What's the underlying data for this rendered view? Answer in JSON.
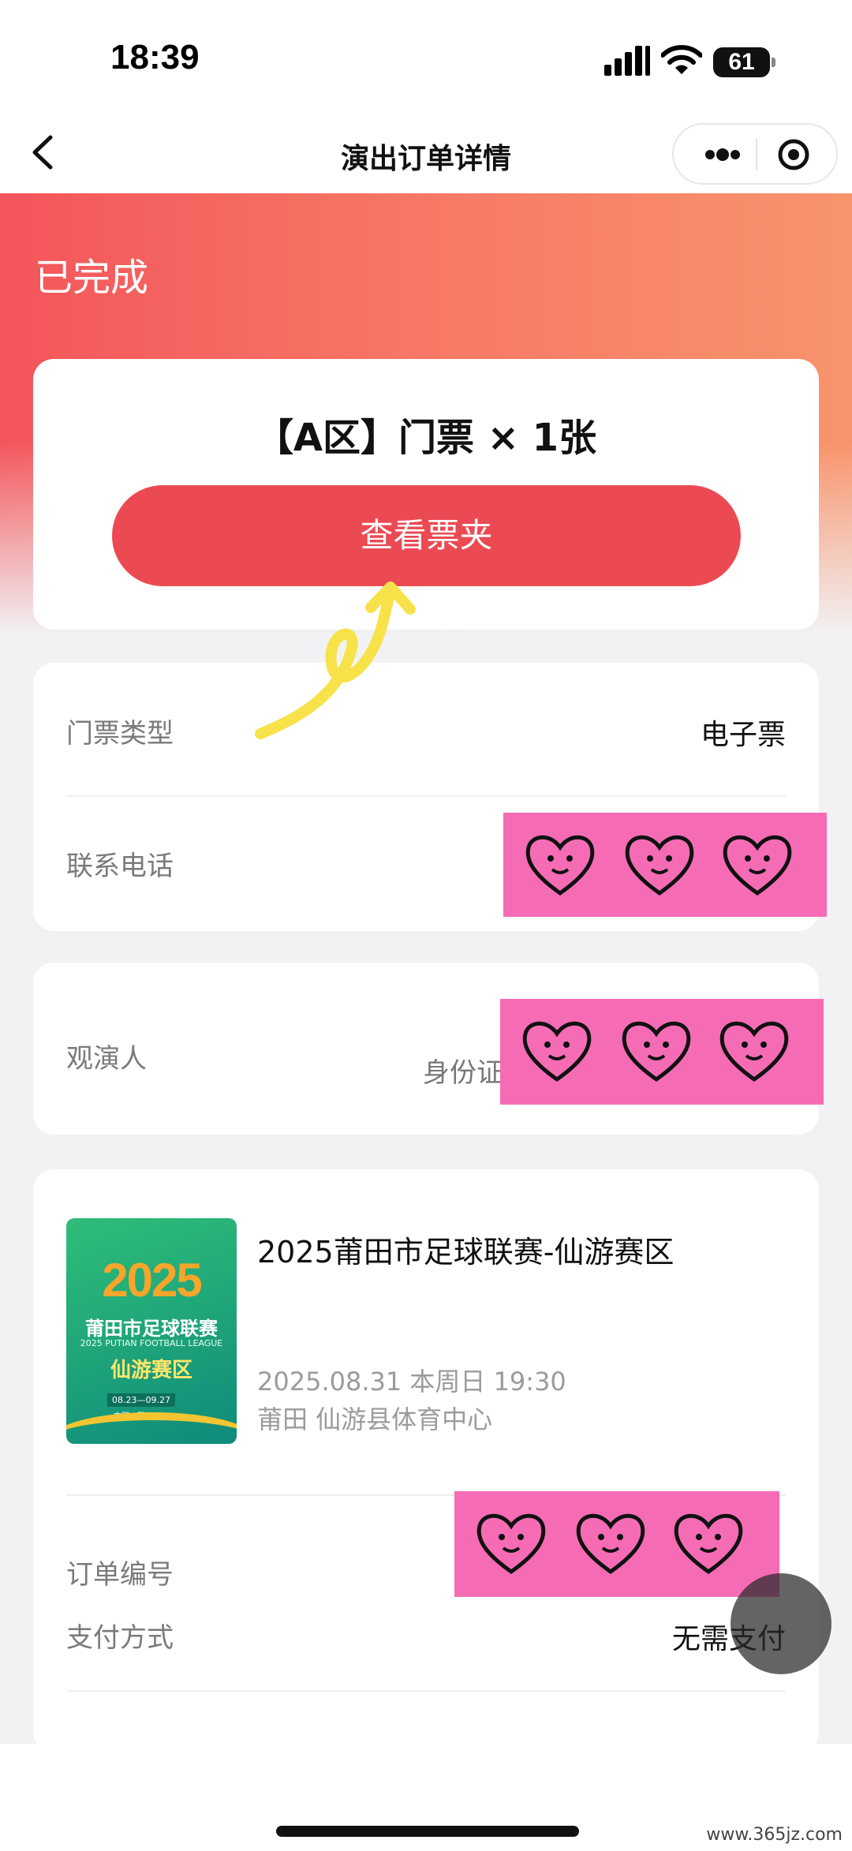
{
  "status_bar": {
    "time": "18:39",
    "battery": "61"
  },
  "nav": {
    "title": "演出订单详情"
  },
  "header": {
    "order_status": "已完成"
  },
  "ticket": {
    "summary": "【A区】门票 × 1张",
    "view_button": "查看票夹"
  },
  "info": {
    "ticket_type_label": "门票类型",
    "ticket_type_value": "电子票",
    "phone_label": "联系电话"
  },
  "viewer": {
    "label": "观演人",
    "id_type": "身份证"
  },
  "event": {
    "poster": {
      "year": "2025",
      "line1": "莆田市足球联赛",
      "line2": "2025 PUTIAN FOOTBALL LEAGUE",
      "line3": "仙游赛区",
      "dates": "08.23—09.27",
      "place": "中国 · 莆田"
    },
    "title": "2025莆田市足球联赛-仙游赛区",
    "time": "2025.08.31 本周日 19:30",
    "venue": "莆田 仙游县体育中心"
  },
  "order": {
    "number_label": "订单编号",
    "payment_label": "支付方式",
    "payment_value": "无需支付"
  },
  "watermark": {
    "site": "www.365jz.com"
  },
  "colors": {
    "header_start": "#f3555b",
    "header_end": "#f8946c",
    "button": "#eb4a53",
    "sticker": "#f56cb5",
    "doodle": "#f7e24a"
  }
}
